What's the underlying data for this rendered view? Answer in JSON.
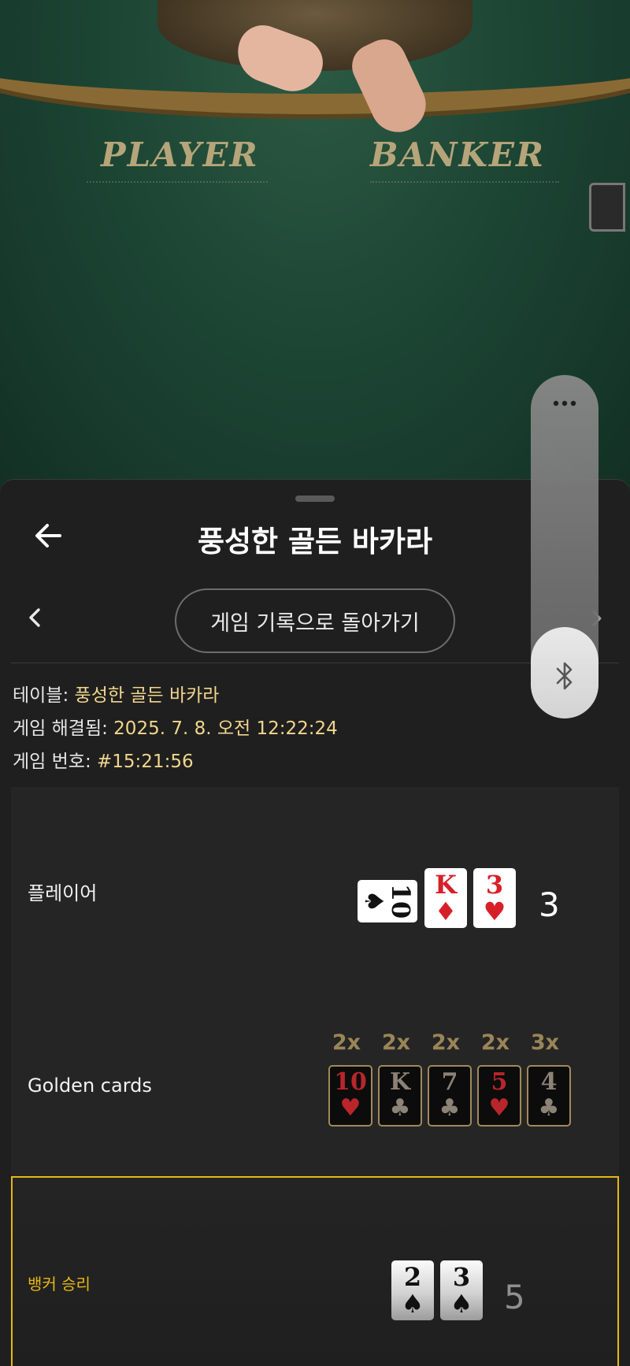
{
  "video": {
    "felt_player": "PLAYER",
    "felt_banker": "BANKER"
  },
  "sheet": {
    "title": "풍성한 골든 바카라",
    "back_to_history_label": "게임 기록으로 돌아가기"
  },
  "info": {
    "table_label": "테이블: ",
    "table_value": "풍성한 골든 바카라",
    "resolved_label": "게임 해결됨: ",
    "resolved_value": "2025. 7. 8. 오전 12:22:24",
    "round_label": "게임 번호: ",
    "round_value": "#15:21:56"
  },
  "player": {
    "label": "플레이어",
    "cards": [
      {
        "rank": "10",
        "suit": "♠",
        "color": "black",
        "orientation": "sideways"
      },
      {
        "rank": "K",
        "suit": "♦",
        "color": "red"
      },
      {
        "rank": "3",
        "suit": "♥",
        "color": "red"
      }
    ],
    "total": "3"
  },
  "golden": {
    "label": "Golden cards",
    "cards": [
      {
        "multiplier": "2x",
        "rank": "10",
        "suit": "♥",
        "color": "red"
      },
      {
        "multiplier": "2x",
        "rank": "K",
        "suit": "♣",
        "color": "black"
      },
      {
        "multiplier": "2x",
        "rank": "7",
        "suit": "♣",
        "color": "black"
      },
      {
        "multiplier": "2x",
        "rank": "5",
        "suit": "♥",
        "color": "red"
      },
      {
        "multiplier": "3x",
        "rank": "4",
        "suit": "♣",
        "color": "black"
      }
    ]
  },
  "banker": {
    "label": "뱅커 승리",
    "cards": [
      {
        "rank": "2",
        "suit": "♠",
        "color": "black"
      },
      {
        "rank": "3",
        "suit": "♠",
        "color": "black"
      }
    ],
    "total": "5",
    "label_color": "#e6b815"
  },
  "icons": [
    "back-arrow-icon",
    "chevron-left-icon",
    "chevron-right-icon",
    "more-dots-icon",
    "bluetooth-icon"
  ],
  "colors": {
    "accent_gold": "#f1d68d",
    "winner_border": "#e6b815",
    "card_red": "#d71f2a"
  }
}
